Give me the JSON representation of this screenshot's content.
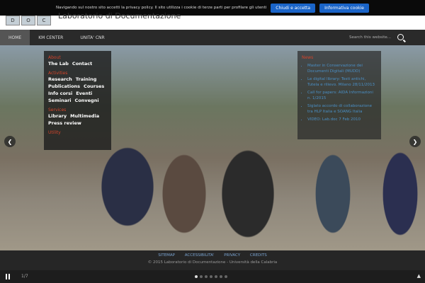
{
  "cookie": {
    "text": "Navigando sul nostro sito accetti la privacy policy. Il sito utilizza i cookie di terze parti per profilare gli utenti",
    "accept": "Chiudi e accetta",
    "info": "Informativa cookie"
  },
  "header": {
    "logo": [
      "D",
      "O",
      "C"
    ],
    "title": "Laboratorio di Documentazione"
  },
  "nav": {
    "items": [
      "HOME",
      "KM CENTER",
      "UNITA' CNR"
    ],
    "search_placeholder": "Search this website..."
  },
  "menu": {
    "about": "About",
    "about_links": [
      "The Lab",
      "Contact"
    ],
    "activities": "Activities",
    "activities_rows": [
      [
        "Research",
        "Training"
      ],
      [
        "Publications",
        "Courses"
      ],
      [
        "Info corsi",
        "Eventi"
      ],
      [
        "Seminari",
        "Convegni"
      ]
    ],
    "services": "Services",
    "services_rows": [
      [
        "Library",
        "Multimedia"
      ],
      [
        "Press review"
      ]
    ],
    "utility": "Utility"
  },
  "news": {
    "title": "News",
    "items": [
      "Master in Conservazione dei Documenti Digitali (MUDD)",
      "Le digital library: Testi antichi, Tutela e rilievo. Milano 28/11/2013",
      "Call for papers: AIDA Informazioni n. 1/2015",
      "Siglato accordo di collaborazione tra HLP Italia e SOANG Italia",
      "VIDEO: Lab.doc 7 Feb 2010"
    ]
  },
  "footer": {
    "links": [
      "SITEMAP",
      "ACCESSIBILITA'",
      "PRIVACY",
      "CREDITS"
    ],
    "copyright": "© 2015 Laboratorio di Documentazione - Università della Calabria"
  },
  "slider": {
    "counter": "1/7",
    "total": 7,
    "current": 1
  }
}
